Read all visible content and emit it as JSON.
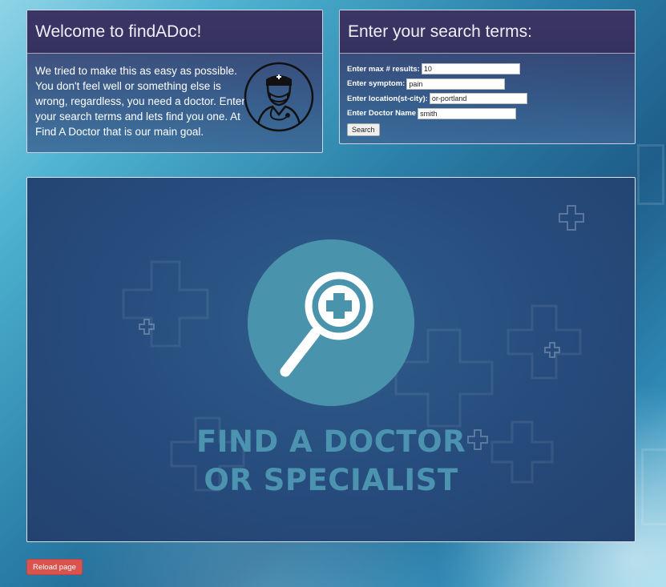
{
  "welcome": {
    "title": "Welcome to findADoc!",
    "text": "We tried to make this as easy as possible. You don't feel well or something else is wrong, regardless, you need a doctor. Enter your search terms and lets find you one. At Find A Doctor that is our main goal.",
    "icon": "doctor-icon"
  },
  "search": {
    "title": "Enter your search terms:",
    "fields": {
      "max_results": {
        "label": "Enter max # results:",
        "value": "10"
      },
      "symptom": {
        "label": "Enter symptom:",
        "value": "pain"
      },
      "location": {
        "label": "Enter location(st-city):",
        "value": "or-portland"
      },
      "doctor_name": {
        "label": "Enter Doctor Name",
        "value": "smith"
      }
    },
    "button_label": "Search"
  },
  "hero": {
    "line1": "FIND A DOCTOR",
    "line2": "OR SPECIALIST",
    "icon": "magnifier-medical-cross-icon",
    "circle_color": "#4a93ad"
  },
  "reload_label": "Reload page",
  "colors": {
    "panel_header": "#3b3566",
    "reload_button": "#d9534f",
    "hero_text": "#4c93b0"
  }
}
